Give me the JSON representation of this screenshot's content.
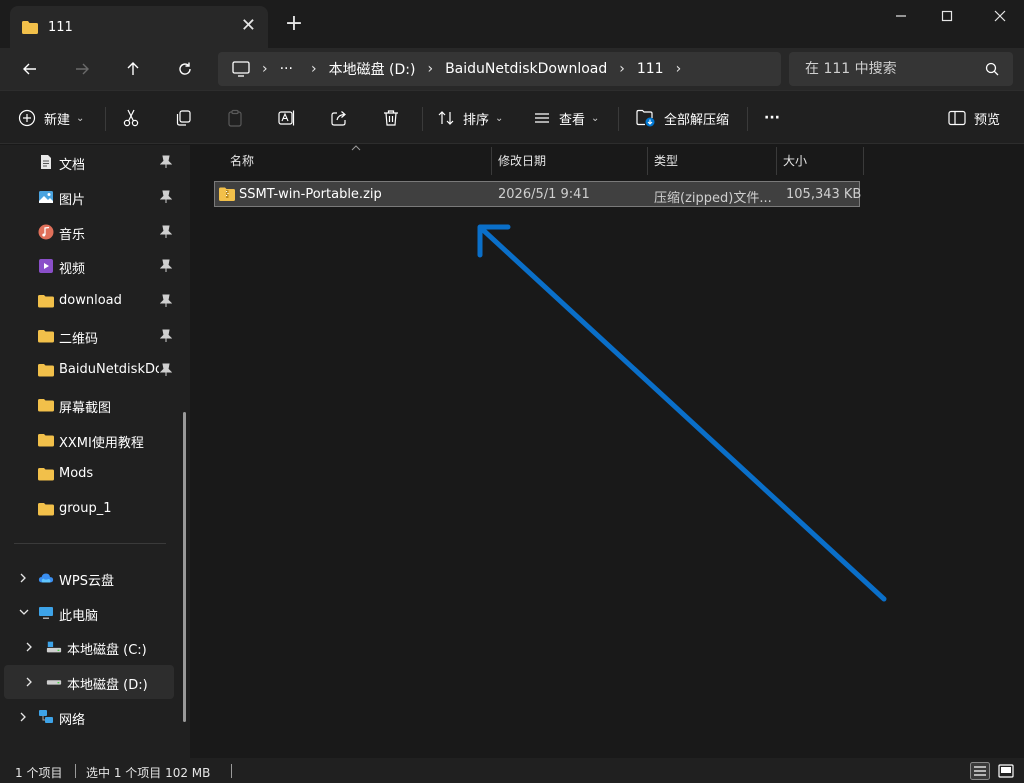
{
  "tab": {
    "title": "111",
    "close": "✕",
    "new": "+"
  },
  "window": {
    "minimize": "—",
    "maximize": "☐",
    "close": "✕"
  },
  "address": {
    "more": "···",
    "crumbs": [
      "本地磁盘 (D:)",
      "BaiduNetdiskDownload",
      "111"
    ],
    "sep": "›"
  },
  "search": {
    "placeholder": "在 111 中搜索"
  },
  "toolbar": {
    "new_label": "新建",
    "sort_label": "排序",
    "view_label": "查看",
    "extract_label": "全部解压缩",
    "more_label": "···",
    "preview_label": "预览"
  },
  "sidebar": {
    "pinned": [
      {
        "label": "文档",
        "icon": "documents-icon"
      },
      {
        "label": "图片",
        "icon": "pictures-icon"
      },
      {
        "label": "音乐",
        "icon": "music-icon"
      },
      {
        "label": "视频",
        "icon": "videos-icon"
      },
      {
        "label": "download",
        "icon": "folder-icon"
      },
      {
        "label": "二维码",
        "icon": "folder-icon"
      },
      {
        "label": "BaiduNetdiskDownload",
        "icon": "folder-icon"
      },
      {
        "label": "屏幕截图",
        "icon": "folder-icon"
      },
      {
        "label": "XXMI使用教程",
        "icon": "folder-icon"
      },
      {
        "label": "Mods",
        "icon": "folder-icon"
      },
      {
        "label": "group_1",
        "icon": "folder-icon"
      }
    ],
    "locations": [
      {
        "label": "WPS云盘",
        "icon": "cloud-icon"
      },
      {
        "label": "此电脑",
        "icon": "computer-icon"
      },
      {
        "label": "本地磁盘 (C:)",
        "icon": "drive-c-icon"
      },
      {
        "label": "本地磁盘 (D:)",
        "icon": "drive-d-icon"
      },
      {
        "label": "网络",
        "icon": "network-icon"
      }
    ]
  },
  "columns": {
    "name": "名称",
    "modified": "修改日期",
    "type": "类型",
    "size": "大小"
  },
  "files": [
    {
      "name": "SSMT-win-Portable.zip",
      "modified": "2026/5/1 9:41",
      "type": "压缩(zipped)文件...",
      "size": "105,343 KB"
    }
  ],
  "status": {
    "count": "1 个项目",
    "selection": "选中 1 个项目 102 MB"
  },
  "colors": {
    "accent": "#0078d4",
    "folder": "#f2c04a",
    "background": "#191919"
  }
}
